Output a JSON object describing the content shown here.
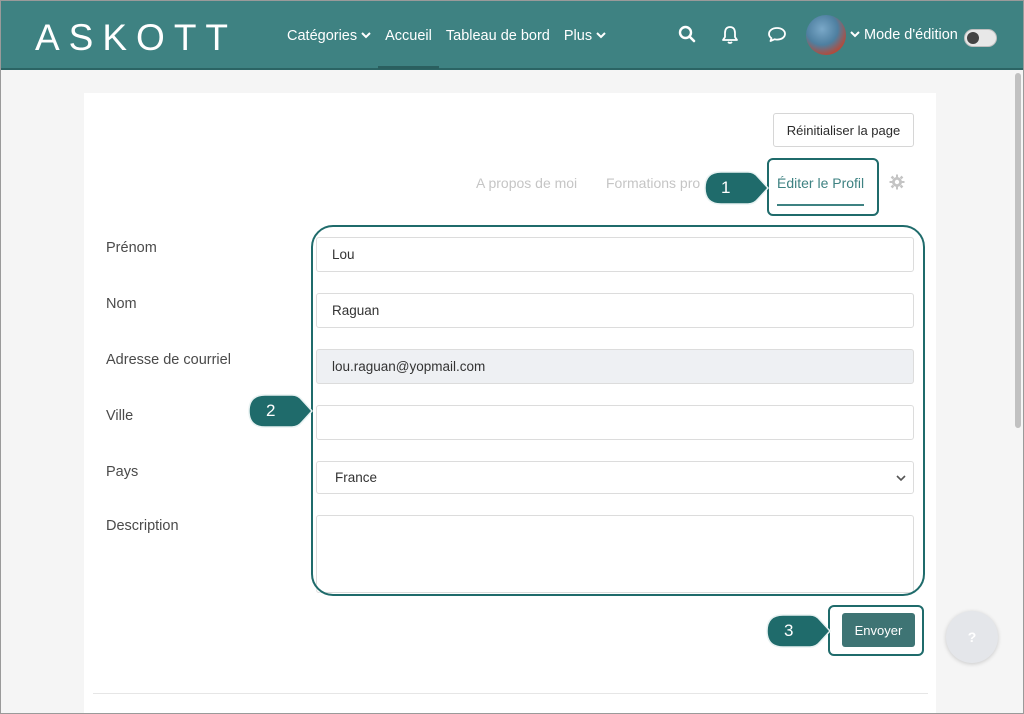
{
  "navbar": {
    "logo": "ASKOTT",
    "links": [
      {
        "label": "Catégories",
        "has_dropdown": true
      },
      {
        "label": "Accueil",
        "active": true
      },
      {
        "label": "Tableau de bord"
      },
      {
        "label": "Plus",
        "has_dropdown": true
      }
    ],
    "icons": [
      "search-icon",
      "bell-icon",
      "chat-icon"
    ],
    "mode_label": "Mode d'édition",
    "mode_enabled": false
  },
  "page": {
    "reset_button": "Réinitialiser la page",
    "tabs": [
      {
        "label": "A propos de moi"
      },
      {
        "label": "Formations pro"
      },
      {
        "label": "Éditer le Profil",
        "active": true
      }
    ]
  },
  "form": {
    "fields": [
      {
        "label": "Prénom",
        "value": "Lou"
      },
      {
        "label": "Nom",
        "value": "Raguan"
      },
      {
        "label": "Adresse de courriel",
        "value": "lou.raguan@yopmail.com",
        "readonly": true
      },
      {
        "label": "Ville",
        "value": ""
      },
      {
        "label": "Pays",
        "value": "France",
        "type": "select"
      },
      {
        "label": "Description",
        "value": "",
        "type": "textarea"
      }
    ],
    "submit_label": "Envoyer"
  },
  "help": {
    "label": "?"
  },
  "callouts": [
    "1",
    "2",
    "3"
  ],
  "colors": {
    "brand": "#3e8282",
    "button": "#3e7474",
    "callout": "#1f6b6b"
  }
}
